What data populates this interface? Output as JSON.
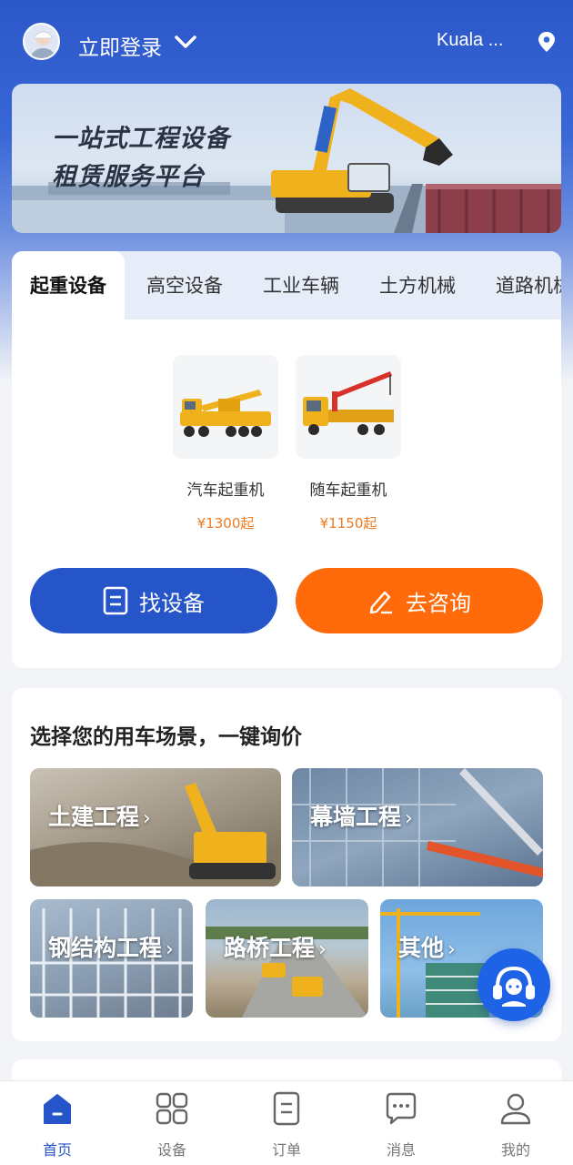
{
  "header": {
    "login_text": "立即登录",
    "city": "Kuala ..."
  },
  "banner": {
    "line1": "一站式工程设备",
    "line2": "租赁服务平台"
  },
  "categories": {
    "tabs": [
      "起重设备",
      "高空设备",
      "工业车辆",
      "土方机械",
      "道路机械"
    ],
    "active_index": 0,
    "items": [
      {
        "name": "汽车起重机",
        "price": "¥1300起"
      },
      {
        "name": "随车起重机",
        "price": "¥1150起"
      }
    ],
    "find_button": "找设备",
    "ask_button": "去咨询"
  },
  "scenes": {
    "title": "选择您的用车场景，一键询价",
    "items": [
      "土建工程",
      "幕墙工程",
      "钢结构工程",
      "路桥工程",
      "其他"
    ]
  },
  "nav": {
    "items": [
      "首页",
      "设备",
      "订单",
      "消息",
      "我的"
    ],
    "active_index": 0
  },
  "colors": {
    "primary": "#2555c8",
    "accent": "#ff6b0a",
    "price": "#f07a20"
  }
}
